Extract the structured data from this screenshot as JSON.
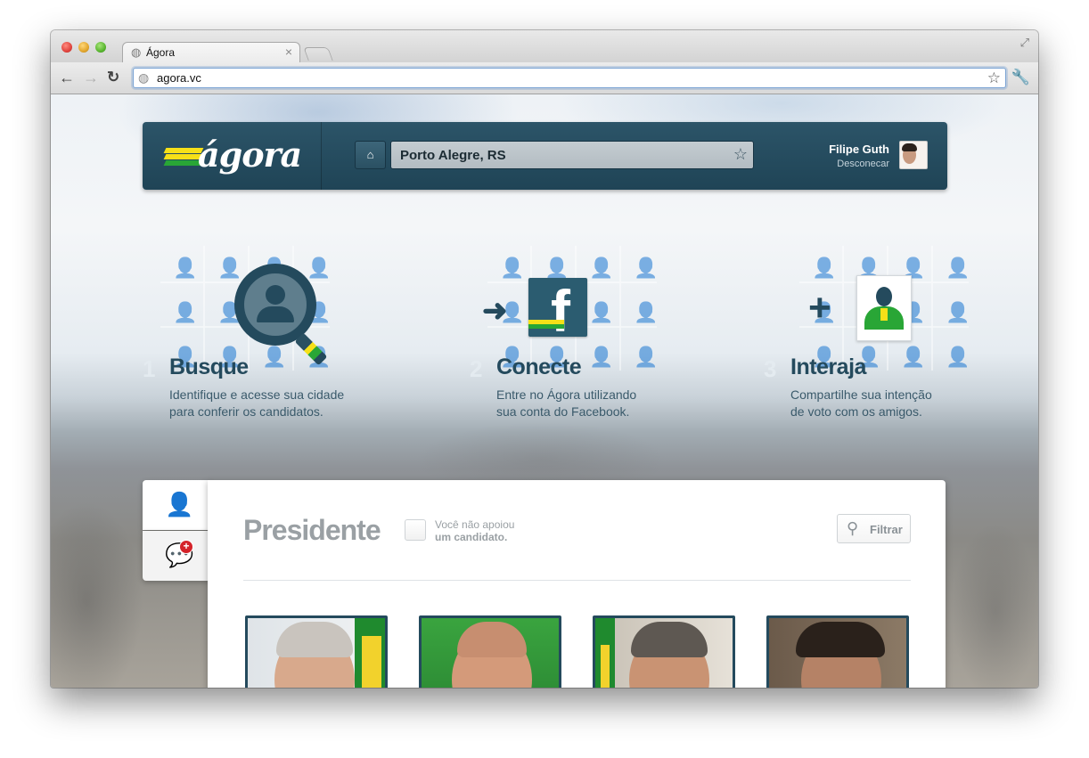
{
  "browser": {
    "tab_title": "Ágora",
    "tab_close": "×",
    "url": "agora.vc"
  },
  "icons": {
    "globe": "globe-icon",
    "back": "arrow-left-icon",
    "forward": "arrow-right-icon",
    "reload": "reload-icon",
    "star": "star-icon",
    "wrench": "wrench-icon",
    "home": "home-icon",
    "user": "user-icon",
    "chat": "chat-add-icon",
    "search": "magnifier-icon"
  },
  "header": {
    "logo": "ágora",
    "location": "Porto Alegre, RS",
    "user_name": "Filipe Guth",
    "logout": "Desconecar"
  },
  "steps": [
    {
      "number": "1",
      "title": "Busque",
      "desc_line1": "Identifique e acesse sua cidade",
      "desc_line2": "para conferir os candidatos."
    },
    {
      "number": "2",
      "title": "Conecte",
      "desc_line1": "Entre no Ágora utilizando",
      "desc_line2": "sua conta do Facebook."
    },
    {
      "number": "3",
      "title": "Interaja",
      "desc_line1": "Compartilhe sua intenção",
      "desc_line2": "de voto com os amigos."
    }
  ],
  "panel": {
    "title": "Presidente",
    "support_line1": "Você não apoiou",
    "support_line2": "um candidato.",
    "filter": "Filtrar",
    "badge": "+"
  },
  "colors": {
    "brand_dark": "#244a5d",
    "brand_green": "#29a636",
    "brand_yellow": "#f6e018"
  }
}
